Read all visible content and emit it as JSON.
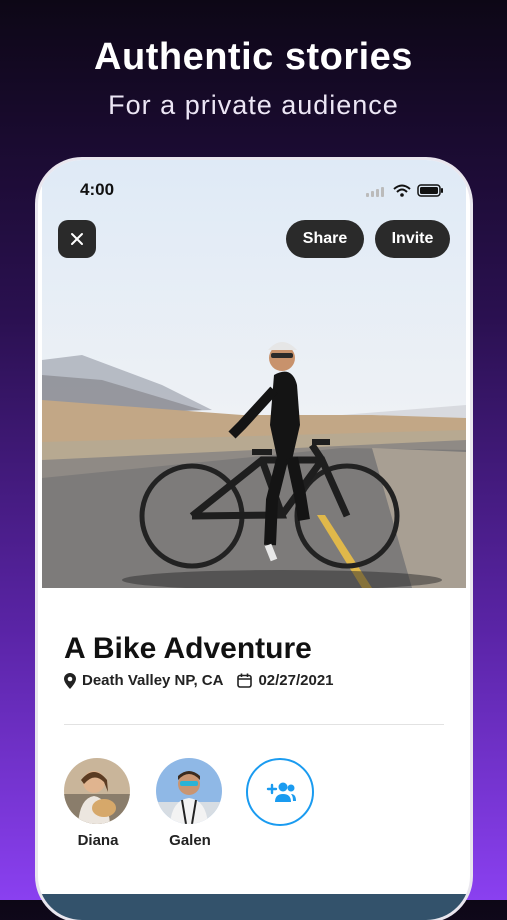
{
  "promo": {
    "headline": "Authentic stories",
    "subheadline": "For a private audience"
  },
  "status_bar": {
    "time": "4:00"
  },
  "toolbar": {
    "share_label": "Share",
    "invite_label": "Invite"
  },
  "story": {
    "title": "A Bike Adventure",
    "location": "Death Valley NP, CA",
    "date": "02/27/2021"
  },
  "members": [
    {
      "name": "Diana"
    },
    {
      "name": "Galen"
    }
  ],
  "colors": {
    "accent": "#1a9bf0",
    "button_bg": "#2a2a2a",
    "background_top": "#0d0716",
    "background_bottom": "#8a40f0"
  },
  "icons": {
    "close": "close-icon",
    "location": "location-pin-icon",
    "calendar": "calendar-icon",
    "add_member": "add-people-icon"
  }
}
